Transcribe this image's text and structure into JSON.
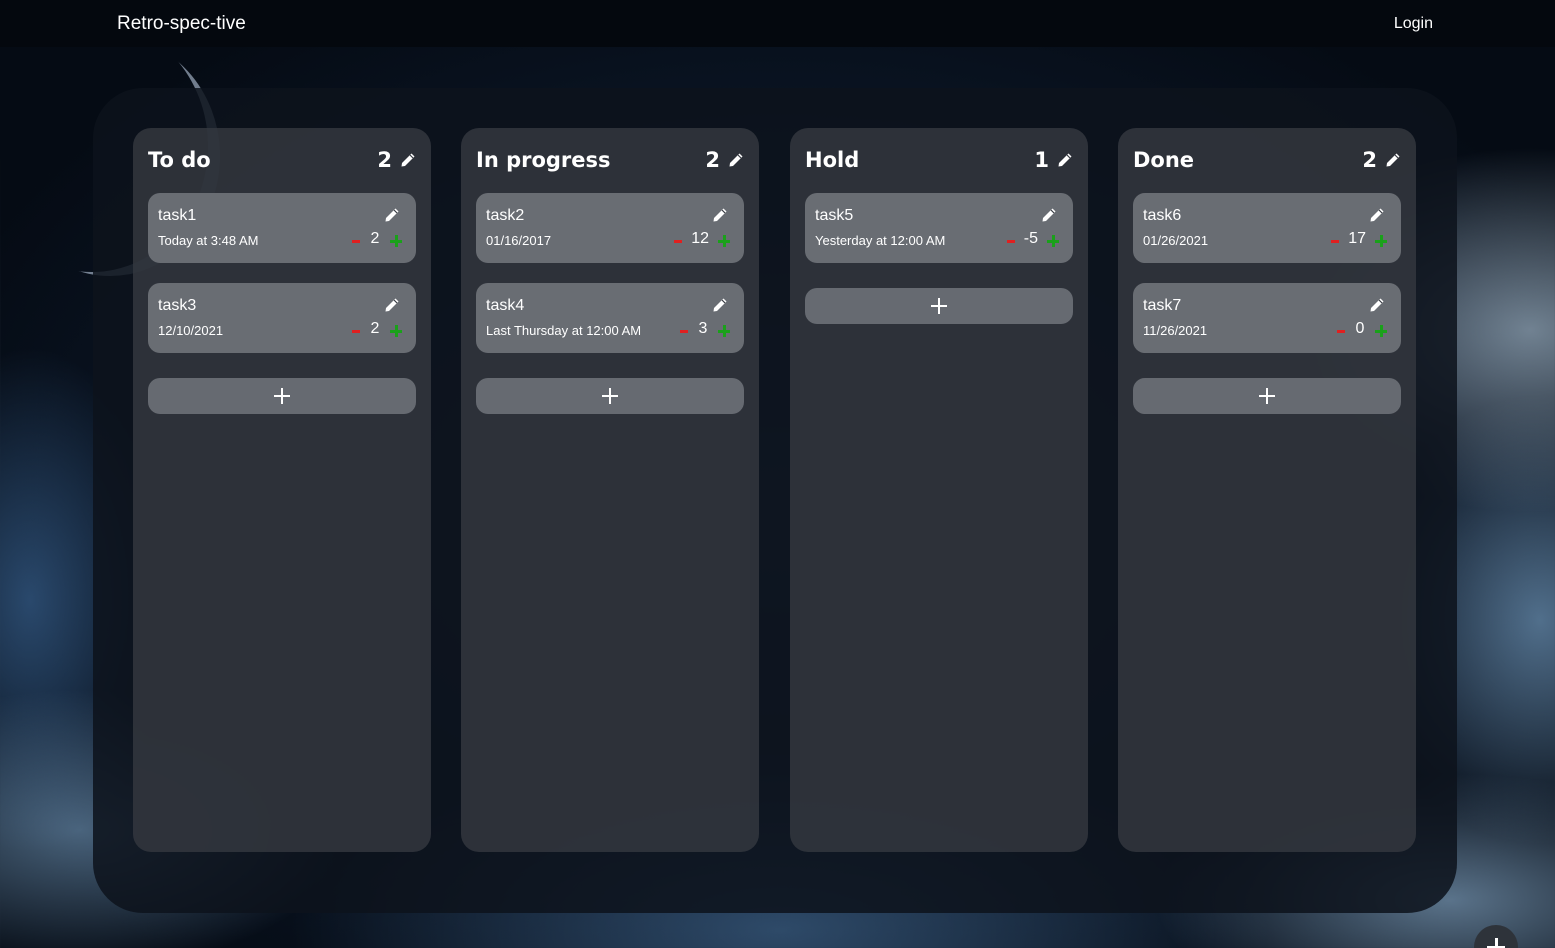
{
  "app": {
    "brand": "Retro-spec-tive",
    "login_label": "Login"
  },
  "colors": {
    "minus": "#e02020",
    "plus": "#1aa11a",
    "card": "#696d73"
  },
  "icons": {
    "edit": "pencil-icon",
    "downvote": "minus-icon",
    "upvote": "plus-icon",
    "add": "plus-icon"
  },
  "columns": [
    {
      "title": "To do",
      "count": "2",
      "cards": [
        {
          "title": "task1",
          "date": "Today at 3:48 AM",
          "votes": "2"
        },
        {
          "title": "task3",
          "date": "12/10/2021",
          "votes": "2"
        }
      ]
    },
    {
      "title": "In progress",
      "count": "2",
      "cards": [
        {
          "title": "task2",
          "date": "01/16/2017",
          "votes": "12"
        },
        {
          "title": "task4",
          "date": "Last Thursday at 12:00 AM",
          "votes": "3"
        }
      ]
    },
    {
      "title": "Hold",
      "count": "1",
      "cards": [
        {
          "title": "task5",
          "date": "Yesterday at 12:00 AM",
          "votes": "-5"
        }
      ]
    },
    {
      "title": "Done",
      "count": "2",
      "cards": [
        {
          "title": "task6",
          "date": "01/26/2021",
          "votes": "17"
        },
        {
          "title": "task7",
          "date": "11/26/2021",
          "votes": "0"
        }
      ]
    }
  ]
}
